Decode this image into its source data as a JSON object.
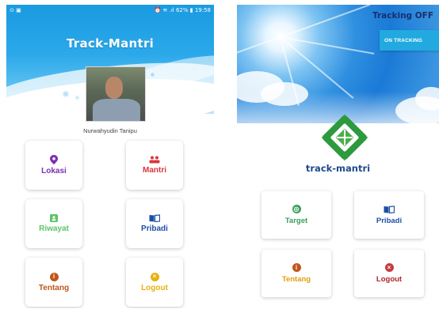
{
  "left_screen": {
    "status_bar": {
      "left_icons": "⊙ ▣",
      "right_text": "⏰ ≋ .ıl 62% ▮ 19:58"
    },
    "title": "Track-Mantri",
    "user_name": "Nurwahyudin Tanipu",
    "menu": [
      {
        "label": "Lokasi",
        "icon": "location-pin-icon",
        "color": "#7b2fb0"
      },
      {
        "label": "Mantri",
        "icon": "people-icon",
        "color": "#d9363e"
      },
      {
        "label": "Riwayat",
        "icon": "history-icon",
        "color": "#5cc46a"
      },
      {
        "label": "Pribadi",
        "icon": "book-icon",
        "color": "#1e4fa6"
      },
      {
        "label": "Tentang",
        "icon": "info-icon",
        "color": "#c0561a"
      },
      {
        "label": "Logout",
        "icon": "logout-icon",
        "color": "#e8b010"
      }
    ]
  },
  "right_screen": {
    "tracking_title": "Tracking OFF",
    "on_button": "ON TRACKING",
    "logo_text": "track-mantri",
    "menu": [
      {
        "label": "Target",
        "icon": "target-icon",
        "color": "#3a9d5a"
      },
      {
        "label": "Pribadi",
        "icon": "book-icon",
        "color": "#1e4fa6"
      },
      {
        "label": "Tentang",
        "icon": "info-icon",
        "color": "#e0a010"
      },
      {
        "label": "Logout",
        "icon": "logout-icon",
        "color": "#b02428"
      }
    ]
  }
}
